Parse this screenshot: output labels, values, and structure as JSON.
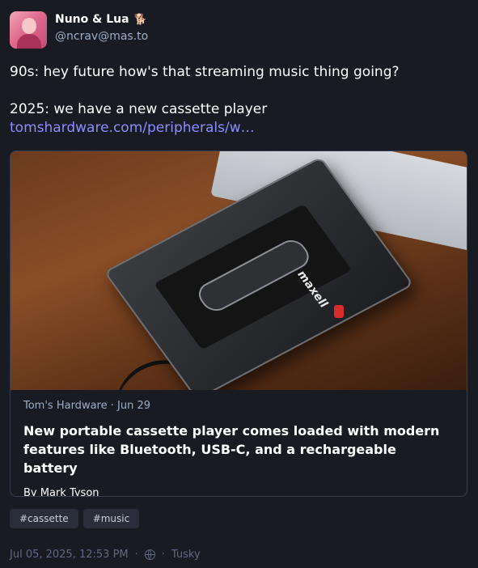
{
  "author": {
    "display_name": "Nuno & Lua",
    "emoji": "🐕",
    "handle": "@ncrav@mas.to",
    "avatar_icon": "profile-photo"
  },
  "post": {
    "line1": "90s: hey future how's that streaming music thing going?",
    "line2": "2025: we have a new cassette player",
    "link": "tomshardware.com/peripherals/w…"
  },
  "card": {
    "source": "Tom's Hardware",
    "separator": " · ",
    "date": "Jun 29",
    "title": "New portable cassette player comes loaded with modern features like Bluetooth, USB-C, and a rechargeable battery",
    "author_prefix": "By ",
    "author": "Mark Tyson",
    "image_brand": "maxell"
  },
  "tags": [
    "#cassette",
    "#music"
  ],
  "footer": {
    "timestamp": "Jul 05, 2025, 12:53 PM",
    "dot1": "·",
    "visibility_icon": "globe-icon",
    "dot2": "·",
    "client": "Tusky"
  },
  "colors": {
    "background": "#191b22",
    "link": "#8c8dff",
    "muted": "#606984",
    "secondary": "#9baec8"
  }
}
